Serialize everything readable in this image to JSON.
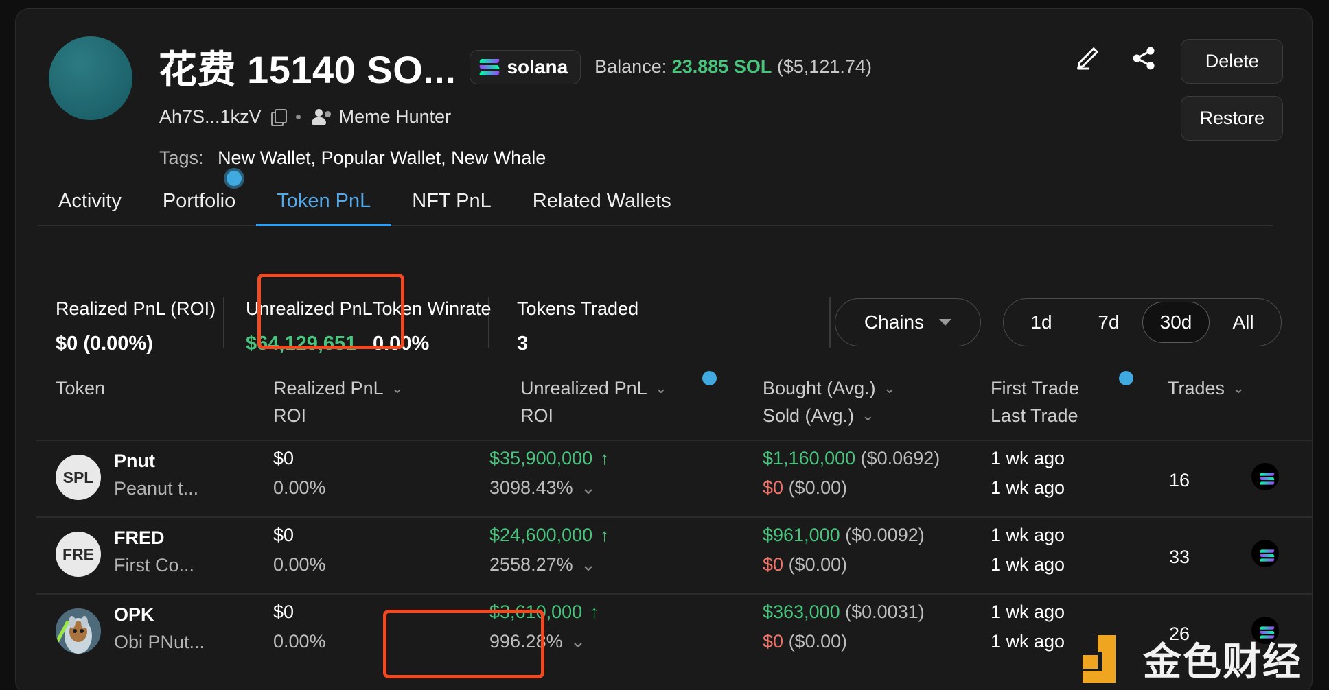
{
  "header": {
    "wallet_title": "花费 15140 SO...",
    "chain_chip": {
      "icon": "solana-icon",
      "label": "solana"
    },
    "balance_label": "Balance:",
    "balance_amount": "23.885 SOL",
    "balance_usd": "($5,121.74)",
    "address": "Ah7S...1kzV",
    "copy_icon": "copy-icon",
    "group_icon": "users-icon",
    "group_label": "Meme Hunter",
    "tags_label": "Tags:",
    "tags_value": "New Wallet, Popular Wallet, New Whale",
    "edit_icon": "pencil-icon",
    "share_icon": "share-icon",
    "delete_label": "Delete",
    "restore_label": "Restore"
  },
  "tabs": [
    {
      "label": "Activity",
      "active": false
    },
    {
      "label": "Portfolio",
      "active": false
    },
    {
      "label": "Token PnL",
      "active": true
    },
    {
      "label": "NFT PnL",
      "active": false
    },
    {
      "label": "Related Wallets",
      "active": false
    }
  ],
  "stats": [
    {
      "key": "Realized PnL (ROI)",
      "value": "$0 (0.00%)",
      "green": false
    },
    {
      "key": "Unrealized PnL",
      "value": "$64,129,651",
      "green": true
    },
    {
      "key": "Token Winrate",
      "value": "0.00%",
      "green": false
    },
    {
      "key": "Tokens Traded",
      "value": "3",
      "green": false
    }
  ],
  "filters": {
    "chains_label": "Chains",
    "chains_chevron": "chevron-down-icon",
    "ranges": [
      {
        "label": "1d",
        "active": false
      },
      {
        "label": "7d",
        "active": false
      },
      {
        "label": "30d",
        "active": true
      },
      {
        "label": "All",
        "active": false
      }
    ]
  },
  "table": {
    "headers": {
      "token": "Token",
      "realized_l1": "Realized PnL",
      "realized_l2": "ROI",
      "unrealized_l1": "Unrealized PnL",
      "unrealized_l2": "ROI",
      "bought_l1": "Bought (Avg.)",
      "bought_l2": "Sold (Avg.)",
      "trade_l1": "First Trade",
      "trade_l2": "Last Trade",
      "trades": "Trades"
    },
    "rows": [
      {
        "avatar_text": "SPL",
        "avatar_kind": "text",
        "name": "Pnut",
        "sub": "Peanut t...",
        "realized": "$0",
        "realized_roi": "0.00%",
        "unrealized": "$35,900,000",
        "unrealized_arrow": "↑",
        "unrealized_roi": "3098.43%",
        "bought": "$1,160,000",
        "bought_avg": "($0.0692)",
        "sold": "$0",
        "sold_avg": "($0.00)",
        "first_trade": "1 wk ago",
        "last_trade": "1 wk ago",
        "trades": "16",
        "chain_icon": "solana-icon"
      },
      {
        "avatar_text": "FRE",
        "avatar_kind": "text",
        "name": "FRED",
        "sub": "First Co...",
        "realized": "$0",
        "realized_roi": "0.00%",
        "unrealized": "$24,600,000",
        "unrealized_arrow": "↑",
        "unrealized_roi": "2558.27%",
        "bought": "$961,000",
        "bought_avg": "($0.0092)",
        "sold": "$0",
        "sold_avg": "($0.00)",
        "first_trade": "1 wk ago",
        "last_trade": "1 wk ago",
        "trades": "33",
        "chain_icon": "solana-icon"
      },
      {
        "avatar_text": "",
        "avatar_kind": "image",
        "name": "OPK",
        "sub": "Obi PNut...",
        "realized": "$0",
        "realized_roi": "0.00%",
        "unrealized": "$3,610,000",
        "unrealized_arrow": "↑",
        "unrealized_roi": "996.28%",
        "bought": "$363,000",
        "bought_avg": "($0.0031)",
        "sold": "$0",
        "sold_avg": "($0.00)",
        "first_trade": "1 wk ago",
        "last_trade": "1 wk ago",
        "trades": "26",
        "chain_icon": "solana-icon"
      }
    ]
  },
  "watermark": {
    "text": "金色财经"
  },
  "colors": {
    "accent_blue": "#3b9ae1",
    "positive_green": "#4ac47d",
    "negative_red": "#f0736a",
    "highlight_orange": "#f04a23",
    "watermark_orange": "#f0a521"
  }
}
